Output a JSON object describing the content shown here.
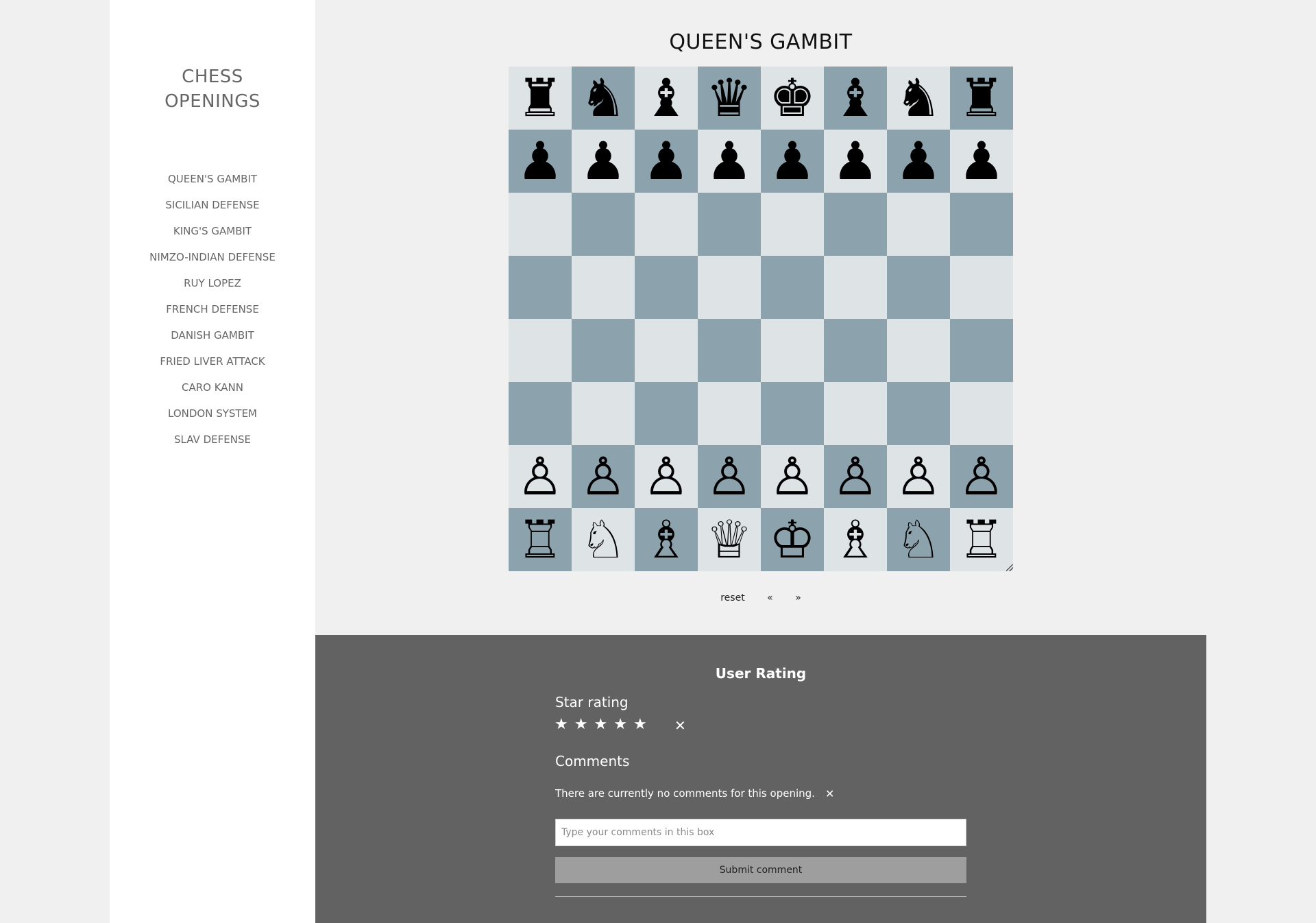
{
  "sidebar": {
    "title": "CHESS OPENINGS",
    "items": [
      {
        "label": "QUEEN'S GAMBIT"
      },
      {
        "label": "SICILIAN DEFENSE"
      },
      {
        "label": "KING'S GAMBIT"
      },
      {
        "label": "NIMZO-INDIAN DEFENSE"
      },
      {
        "label": "RUY LOPEZ"
      },
      {
        "label": "FRENCH DEFENSE"
      },
      {
        "label": "DANISH GAMBIT"
      },
      {
        "label": "FRIED LIVER ATTACK"
      },
      {
        "label": "CARO KANN"
      },
      {
        "label": "LONDON SYSTEM"
      },
      {
        "label": "SLAV DEFENSE"
      }
    ]
  },
  "main": {
    "title": "QUEEN'S GAMBIT",
    "board": {
      "light_color": "#dee3e6",
      "dark_color": "#8ca2ad",
      "rows": [
        [
          "♜",
          "♞",
          "♝",
          "♛",
          "♚",
          "♝",
          "♞",
          "♜"
        ],
        [
          "♟",
          "♟",
          "♟",
          "♟",
          "♟",
          "♟",
          "♟",
          "♟"
        ],
        [
          "",
          "",
          "",
          "",
          "",
          "",
          "",
          ""
        ],
        [
          "",
          "",
          "",
          "",
          "",
          "",
          "",
          ""
        ],
        [
          "",
          "",
          "",
          "",
          "",
          "",
          "",
          ""
        ],
        [
          "",
          "",
          "",
          "",
          "",
          "",
          "",
          ""
        ],
        [
          "♙",
          "♙",
          "♙",
          "♙",
          "♙",
          "♙",
          "♙",
          "♙"
        ],
        [
          "♖",
          "♘",
          "♗",
          "♕",
          "♔",
          "♗",
          "♘",
          "♖"
        ]
      ]
    },
    "controls": {
      "reset": "reset",
      "prev": "«",
      "next": "»"
    }
  },
  "rating": {
    "title": "User Rating",
    "star_label": "Star rating",
    "stars": [
      "★",
      "★",
      "★",
      "★",
      "★"
    ],
    "clear_icon": "✕",
    "comments_label": "Comments",
    "no_comments": "There are currently no comments for this opening.",
    "close_icon": "✕",
    "comment_placeholder": "Type your comments in this box",
    "submit_label": "Submit comment"
  }
}
